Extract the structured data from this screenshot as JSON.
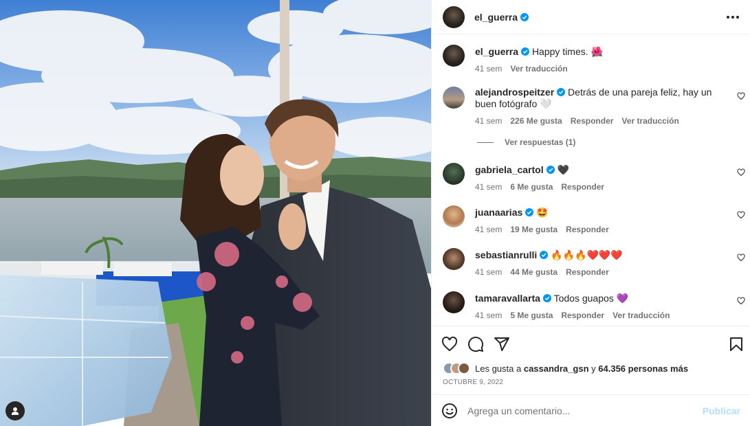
{
  "post": {
    "author": "el_guerra",
    "caption": "Happy times.",
    "caption_emoji": "🌺",
    "caption_time": "41 sem",
    "caption_translate": "Ver traducción"
  },
  "comments": [
    {
      "user": "alejandrospeitzer",
      "text": "Detrás de una pareja feliz, hay un buen fotógrafo 🤍",
      "time": "41 sem",
      "likes": "226 Me gusta",
      "reply": "Responder",
      "translate": "Ver traducción",
      "replies": "Ver respuestas (1)"
    },
    {
      "user": "gabriela_cartol",
      "text": "🖤",
      "time": "41 sem",
      "likes": "6 Me gusta",
      "reply": "Responder"
    },
    {
      "user": "juanaarias",
      "text": "🤩",
      "time": "41 sem",
      "likes": "19 Me gusta",
      "reply": "Responder"
    },
    {
      "user": "sebastianrulli",
      "text": "🔥🔥🔥❤️❤️❤️",
      "time": "41 sem",
      "likes": "44 Me gusta",
      "reply": "Responder"
    },
    {
      "user": "tamaravallarta",
      "text": "Todos guapos 💜",
      "time": "41 sem",
      "likes": "5 Me gusta",
      "reply": "Responder",
      "translate": "Ver traducción"
    }
  ],
  "likes": {
    "prefix": "Les gusta a",
    "first_user": "cassandra_gsn",
    "joiner": "y",
    "others": "64.356 personas más"
  },
  "date": "OCTUBRE 9, 2022",
  "composer": {
    "placeholder": "Agrega un comentario...",
    "publish": "Publicar"
  },
  "icons": {
    "more": "more-icon",
    "like": "heart-icon",
    "comment": "comment-icon",
    "share": "send-icon",
    "save": "bookmark-icon",
    "emoji": "emoji-icon",
    "tag": "user-tag-icon",
    "verified": "verified-badge-icon"
  },
  "colors": {
    "verified": "#0095f6",
    "publish_disabled": "#b2dffc",
    "secondary_text": "#737373"
  }
}
